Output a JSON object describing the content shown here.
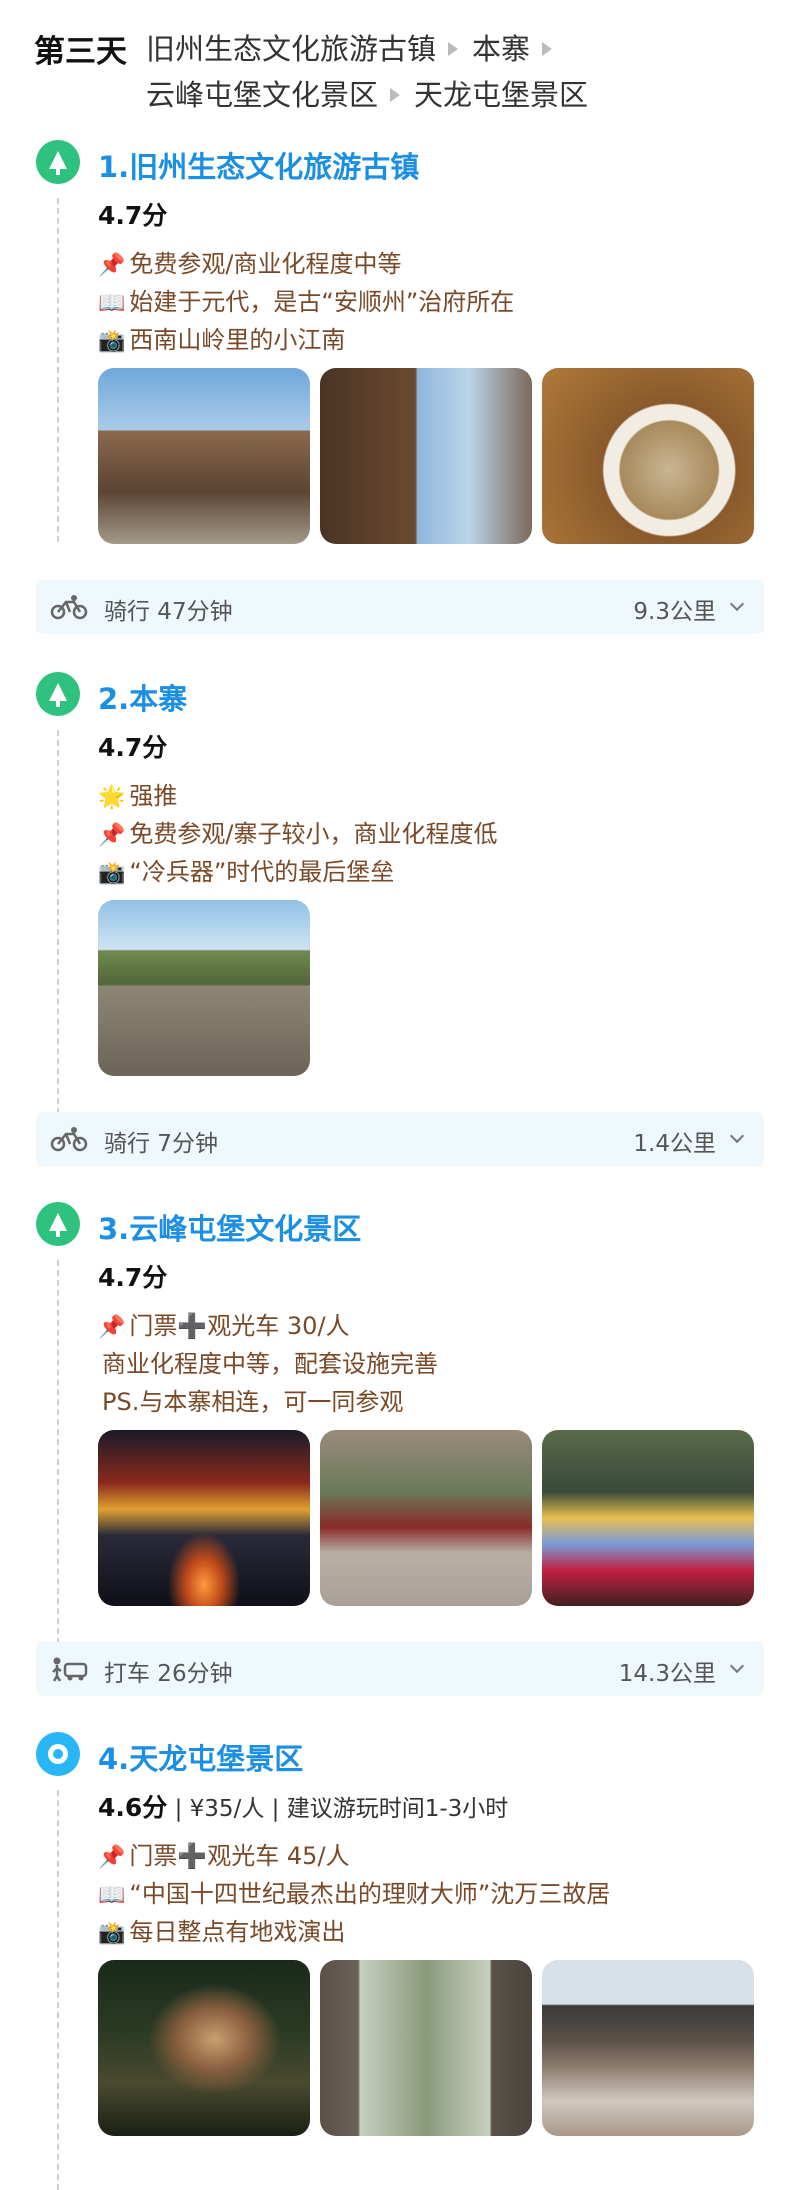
{
  "header": {
    "day": "第三天",
    "route": [
      "旧州生态文化旅游古镇",
      "本寨",
      "云峰屯堡文化景区",
      "天龙屯堡景区"
    ]
  },
  "spots": [
    {
      "title": "1.旧州生态文化旅游古镇",
      "score": "4.7分",
      "lines": [
        {
          "icon": "📌",
          "text": "免费参观/商业化程度中等"
        },
        {
          "icon": "📖",
          "text": "始建于元代，是古“安顺州”治府所在"
        },
        {
          "icon": "📸",
          "text": "西南山岭里的小江南"
        }
      ],
      "photo_names": [
        "old-town-street-photo",
        "signpost-photo",
        "noodle-bowl-photo"
      ]
    },
    {
      "title": "2.本寨",
      "score": "4.7分",
      "lines": [
        {
          "icon": "🌟",
          "text": "强推"
        },
        {
          "icon": "📌",
          "text": "免费参观/寨子较小，商业化程度低"
        },
        {
          "icon": "📸",
          "text": "“冷兵器”时代的最后堡垒"
        }
      ],
      "photo_names": [
        "stone-roof-village-photo"
      ]
    },
    {
      "title": "3.云峰屯堡文化景区",
      "score": "4.7分",
      "lines": [
        {
          "icon": "📌",
          "text": "门票➕观光车 30/人"
        },
        {
          "icon": "",
          "text": "商业化程度中等，配套设施完善"
        },
        {
          "icon": "",
          "text": "PS.与本寨相连，可一同参观"
        }
      ],
      "photo_names": [
        "night-gate-photo",
        "street-performance-photo",
        "stage-opera-photo"
      ]
    },
    {
      "title": "4.天龙屯堡景区",
      "score": "4.6分",
      "score_extra": " | ¥35/人 | 建议游玩时间1-3小时",
      "lines": [
        {
          "icon": "📌",
          "text": "门票➕观光车 45/人"
        },
        {
          "icon": "📖",
          "text": "“中国十四世纪最杰出的理财大师”沈万三故居"
        },
        {
          "icon": "📸",
          "text": "每日整点有地戏演出"
        }
      ],
      "photo_names": [
        "cliff-fortress-photo",
        "stone-gate-photo",
        "courtyard-house-photo"
      ]
    }
  ],
  "transits": [
    {
      "mode": "bike-icon",
      "text": "骑行 47分钟",
      "distance": "9.3公里"
    },
    {
      "mode": "bike-icon",
      "text": "骑行 7分钟",
      "distance": "1.4公里"
    },
    {
      "mode": "taxi-icon",
      "text": "打车 26分钟",
      "distance": "14.3公里"
    }
  ],
  "colors": {
    "title": "#1a8fe3",
    "marker_green": "#2ec27e",
    "marker_blue": "#29b6f6",
    "transit_bg": "#eef8fd",
    "text_brown": "#7a4a28"
  }
}
